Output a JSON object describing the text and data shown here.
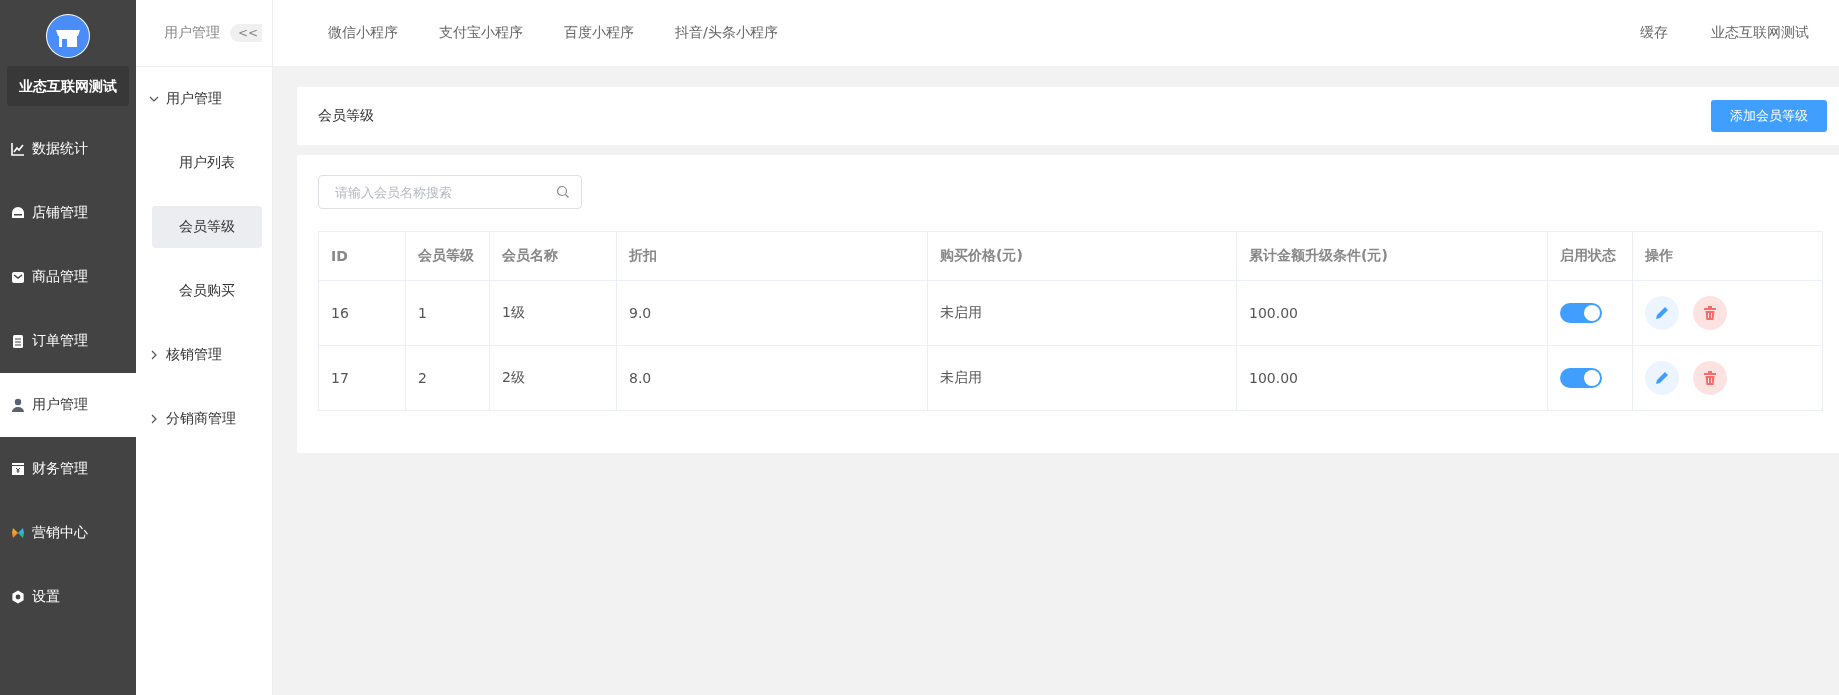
{
  "brand": {
    "name": "业态互联网测试"
  },
  "sidebar": {
    "items": [
      {
        "label": "数据统计",
        "selected": false
      },
      {
        "label": "店铺管理",
        "selected": false
      },
      {
        "label": "商品管理",
        "selected": false
      },
      {
        "label": "订单管理",
        "selected": false
      },
      {
        "label": "用户管理",
        "selected": true
      },
      {
        "label": "财务管理",
        "selected": false
      },
      {
        "label": "营销中心",
        "selected": false
      },
      {
        "label": "设置",
        "selected": false
      }
    ]
  },
  "submenu": {
    "title": "用户管理",
    "collapse": "<<",
    "groups": [
      {
        "label": "用户管理",
        "expanded": true,
        "children": [
          {
            "label": "用户列表",
            "selected": false
          },
          {
            "label": "会员等级",
            "selected": true
          },
          {
            "label": "会员购买",
            "selected": false
          }
        ]
      },
      {
        "label": "核销管理",
        "expanded": false
      },
      {
        "label": "分销商管理",
        "expanded": false
      }
    ]
  },
  "topbar": {
    "tabs": [
      "微信小程序",
      "支付宝小程序",
      "百度小程序",
      "抖音/头条小程序"
    ],
    "cache": "缓存",
    "account": "业态互联网测试"
  },
  "page": {
    "title": "会员等级",
    "add_button": "添加会员等级",
    "search": {
      "placeholder": "请输入会员名称搜索"
    }
  },
  "table": {
    "columns": [
      "ID",
      "会员等级",
      "会员名称",
      "折扣",
      "购买价格(元)",
      "累计金额升级条件(元)",
      "启用状态",
      "操作"
    ],
    "rows": [
      {
        "id": "16",
        "level": "1",
        "name": "1级",
        "discount": "9.0",
        "price": "未启用",
        "upgrade": "100.00",
        "enabled": true
      },
      {
        "id": "17",
        "level": "2",
        "name": "2级",
        "discount": "8.0",
        "price": "未启用",
        "upgrade": "100.00",
        "enabled": true
      }
    ]
  }
}
